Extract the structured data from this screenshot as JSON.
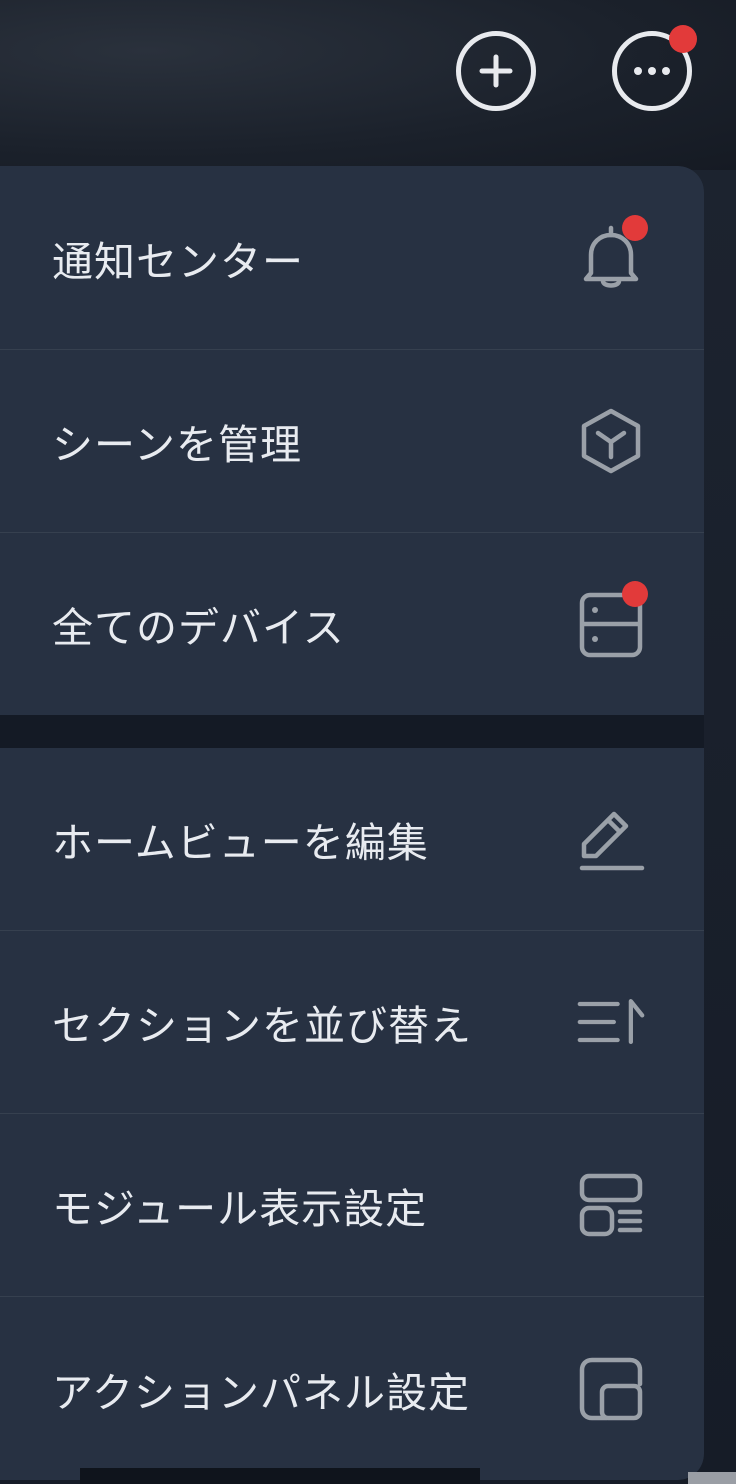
{
  "header": {
    "add_icon": "plus-circle-icon",
    "more_icon": "more-horizontal-icon",
    "more_has_notification": true
  },
  "menu": {
    "groups": [
      {
        "items": [
          {
            "label": "通知センター",
            "icon": "bell-icon",
            "badge": true
          },
          {
            "label": "シーンを管理",
            "icon": "cube-icon",
            "badge": false
          },
          {
            "label": "全てのデバイス",
            "icon": "server-icon",
            "badge": true
          }
        ]
      },
      {
        "items": [
          {
            "label": "ホームビューを編集",
            "icon": "pencil-icon",
            "badge": false
          },
          {
            "label": "セクションを並び替え",
            "icon": "sort-list-icon",
            "badge": false
          },
          {
            "label": "モジュール表示設定",
            "icon": "layout-icon",
            "badge": false
          },
          {
            "label": "アクションパネル設定",
            "icon": "panel-icon",
            "badge": false
          }
        ]
      }
    ]
  },
  "colors": {
    "menu_bg": "#273142",
    "badge": "#e23a3a",
    "icon": "#9aa0a8",
    "text": "#e8ebf0"
  }
}
